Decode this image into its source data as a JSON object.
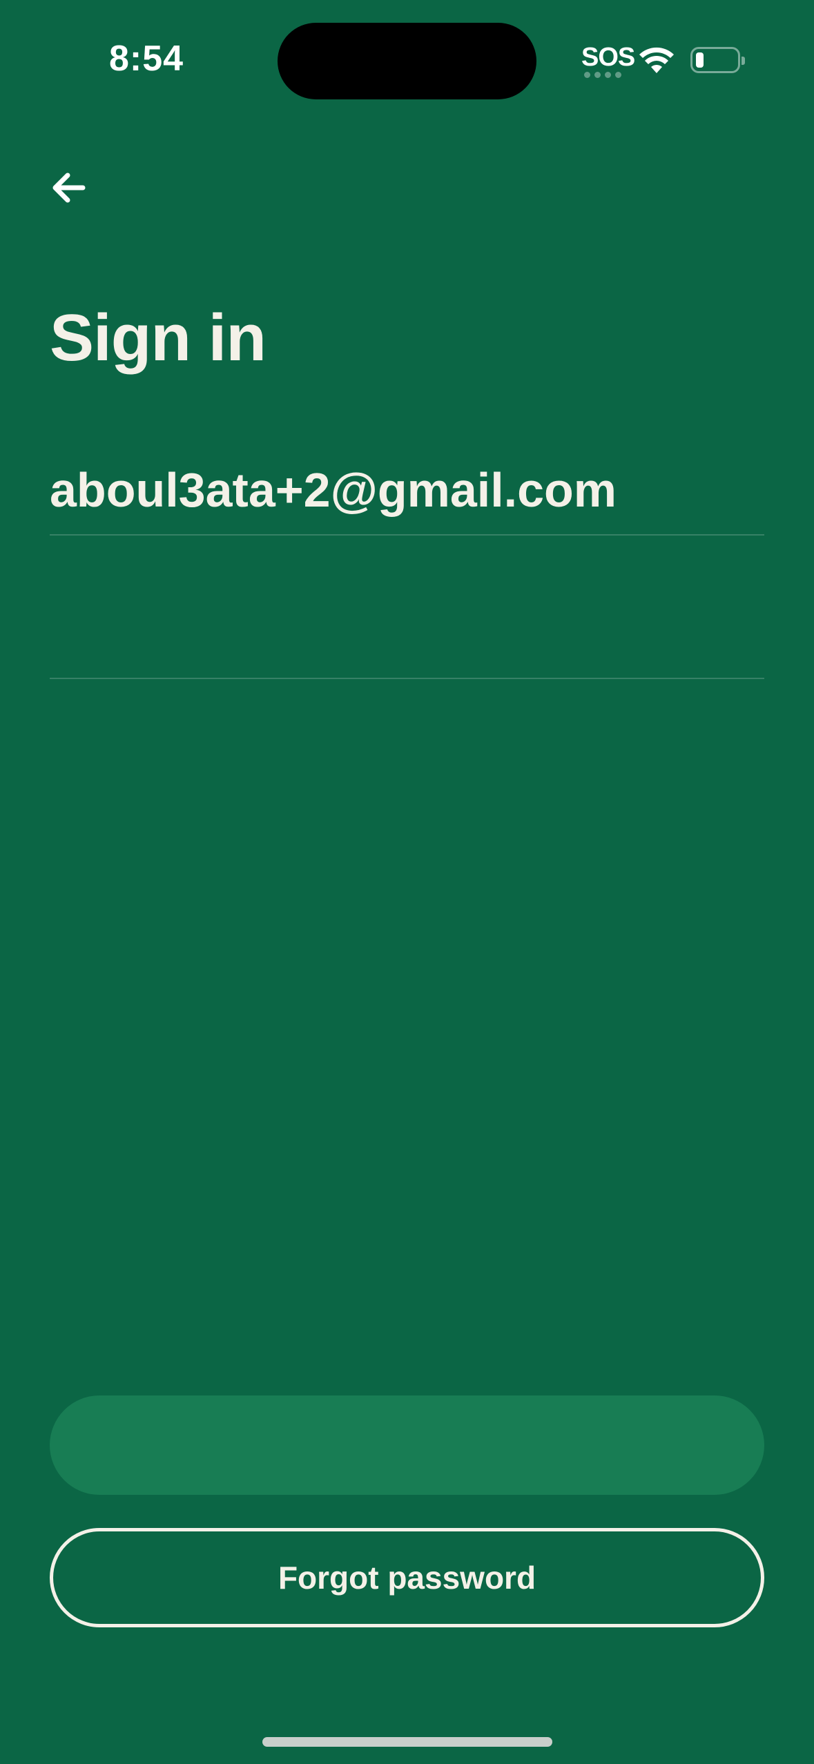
{
  "status_bar": {
    "time": "8:54",
    "sos": "SOS",
    "battery_level": 0.15
  },
  "header": {
    "back_icon": "arrow-left-icon"
  },
  "title": "Sign in",
  "form": {
    "email_value": "aboul3ata+2@gmail.com",
    "password_value": ""
  },
  "actions": {
    "submit_label": "",
    "forgot_password_label": "Forgot password"
  },
  "colors": {
    "background": "#0b6645",
    "text": "#f4f1e8",
    "button_disabled": "#187d54"
  }
}
